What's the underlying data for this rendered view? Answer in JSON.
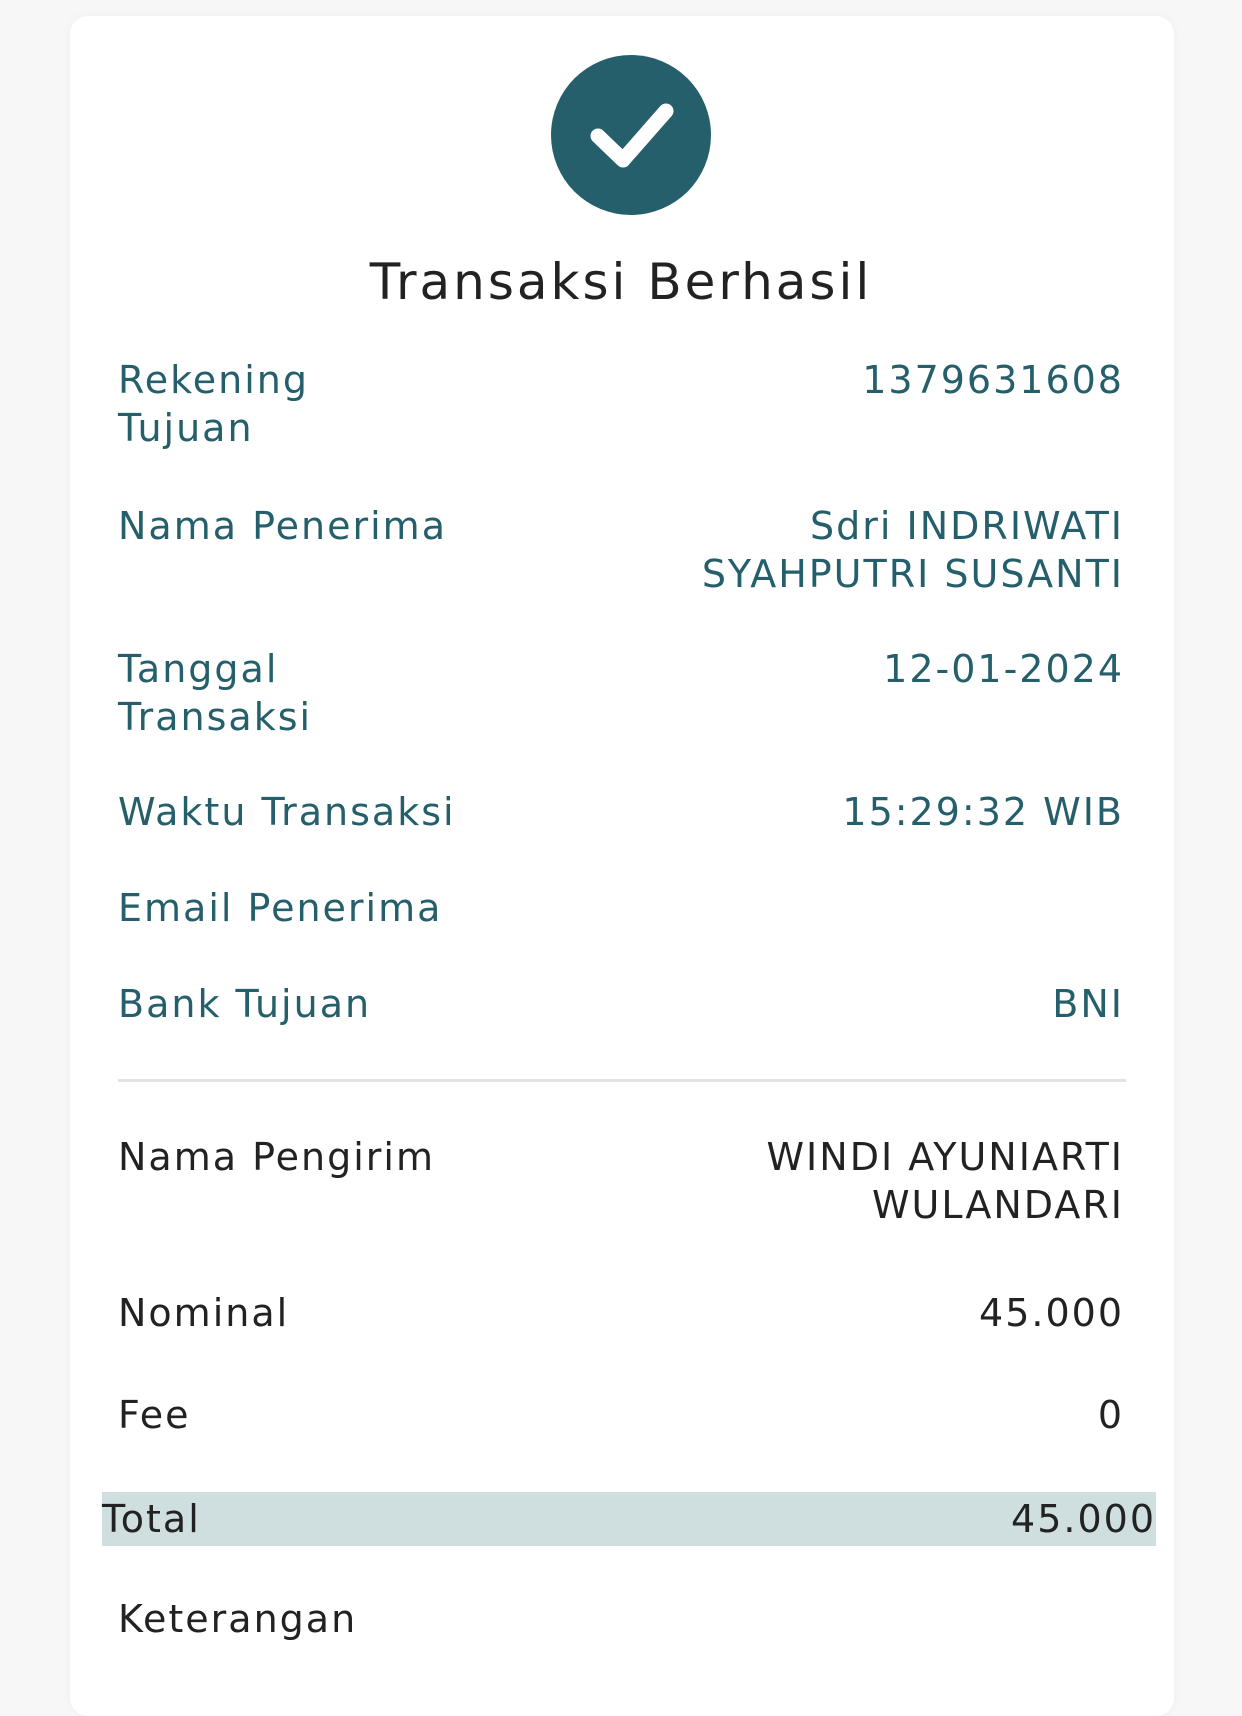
{
  "status": {
    "icon": "check-icon",
    "title": "Transaksi Berhasil",
    "accent_color": "#255f6b"
  },
  "recipient_details": [
    {
      "label": "Rekening Tujuan",
      "value": "1379631608"
    },
    {
      "label": "Nama Penerima",
      "value": "Sdri INDRIWATI SYAHPUTRI SUSANTI"
    },
    {
      "label": "Tanggal Transaksi",
      "value": "12-01-2024"
    },
    {
      "label": "Waktu Transaksi",
      "value": "15:29:32 WIB"
    },
    {
      "label": "Email Penerima",
      "value": ""
    },
    {
      "label": "Bank Tujuan",
      "value": "BNI"
    }
  ],
  "sender_details": [
    {
      "label": "Nama Pengirim",
      "value": "WINDI AYUNIARTI WULANDARI"
    },
    {
      "label": "Nominal",
      "value": "45.000"
    },
    {
      "label": "Fee",
      "value": "0"
    }
  ],
  "total": {
    "label": "Total",
    "value": "45.000",
    "highlight_color": "#cfdfe0"
  },
  "notes": {
    "label": "Keterangan"
  }
}
